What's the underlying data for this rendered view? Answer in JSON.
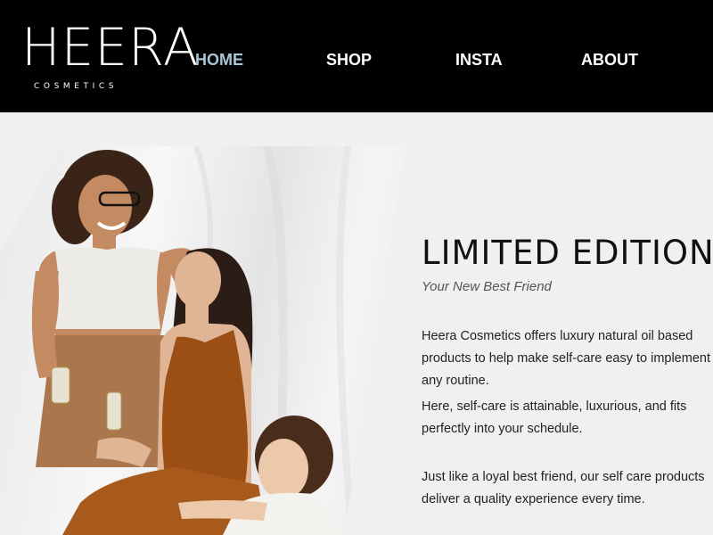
{
  "brand": {
    "name": "HEERA",
    "tagline": "COSMETICS"
  },
  "nav": {
    "items": [
      {
        "label": "HOME",
        "active": true
      },
      {
        "label": "SHOP",
        "active": false
      },
      {
        "label": "INSTA",
        "active": false
      },
      {
        "label": "ABOUT",
        "active": false
      }
    ]
  },
  "hero": {
    "headline": "LIMITED EDITION",
    "subheadline": "Your New Best Friend",
    "paragraphs": [
      "Heera Cosmetics offers luxury natural oil based products to help make self-care easy to implement in any routine.",
      "Here, self-care is attainable, luxurious, and fits perfectly into your schedule.",
      "Just like a loyal best friend, our self care products deliver a quality experience every time."
    ]
  },
  "colors": {
    "header_bg": "#000000",
    "nav_active": "#a7c7d9",
    "page_bg": "#f0f0f0"
  }
}
